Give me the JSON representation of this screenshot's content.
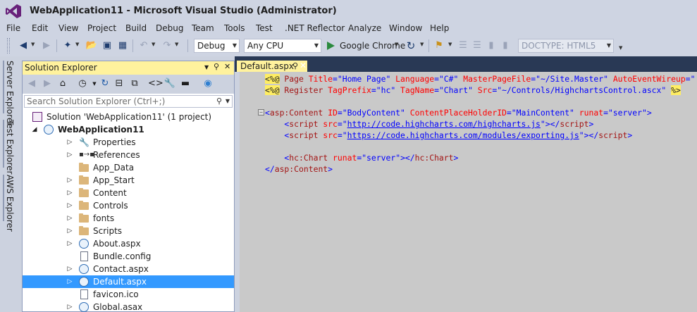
{
  "window": {
    "title": "WebApplication11 - Microsoft Visual Studio (Administrator)"
  },
  "menu": {
    "items": [
      "File",
      "Edit",
      "View",
      "Project",
      "Build",
      "Debug",
      "Team",
      "Tools",
      "Test",
      ".NET Reflector",
      "Analyze",
      "Window",
      "Help"
    ]
  },
  "toolbar": {
    "configuration": "Debug",
    "platform": "Any CPU",
    "run_target": "Google Chrome",
    "doctype": "DOCTYPE: HTML5"
  },
  "side_tabs": [
    "Server Explorer",
    "Test Explorer",
    "AWS Explorer"
  ],
  "solution_explorer": {
    "title": "Solution Explorer",
    "search_placeholder": "Search Solution Explorer (Ctrl+;)",
    "tree": [
      {
        "label": "Solution 'WebApplication11' (1 project)",
        "icon": "solution-icon",
        "level": 0,
        "expander": "none",
        "bold": false
      },
      {
        "label": "WebApplication11",
        "icon": "globe-icon",
        "level": 1,
        "expander": "expanded",
        "bold": true
      },
      {
        "label": "Properties",
        "icon": "wrench-icon",
        "level": 2,
        "expander": "collapsed"
      },
      {
        "label": "References",
        "icon": "references-icon",
        "level": 2,
        "expander": "collapsed"
      },
      {
        "label": "App_Data",
        "icon": "folder-icon",
        "level": 2,
        "expander": "none"
      },
      {
        "label": "App_Start",
        "icon": "folder-icon",
        "level": 2,
        "expander": "collapsed"
      },
      {
        "label": "Content",
        "icon": "folder-icon",
        "level": 2,
        "expander": "collapsed"
      },
      {
        "label": "Controls",
        "icon": "folder-icon",
        "level": 2,
        "expander": "collapsed"
      },
      {
        "label": "fonts",
        "icon": "folder-icon",
        "level": 2,
        "expander": "collapsed"
      },
      {
        "label": "Scripts",
        "icon": "folder-icon",
        "level": 2,
        "expander": "collapsed"
      },
      {
        "label": "About.aspx",
        "icon": "web-file-icon",
        "level": 2,
        "expander": "collapsed"
      },
      {
        "label": "Bundle.config",
        "icon": "file-icon",
        "level": 2,
        "expander": "none"
      },
      {
        "label": "Contact.aspx",
        "icon": "web-file-icon",
        "level": 2,
        "expander": "collapsed"
      },
      {
        "label": "Default.aspx",
        "icon": "web-file-icon",
        "level": 2,
        "expander": "collapsed",
        "selected": true
      },
      {
        "label": "favicon.ico",
        "icon": "file-icon",
        "level": 2,
        "expander": "none"
      },
      {
        "label": "Global.asax",
        "icon": "web-file-icon",
        "level": 2,
        "expander": "collapsed"
      }
    ]
  },
  "editor": {
    "tab_label": "Default.aspx",
    "lines": [
      [
        {
          "t": "<%@",
          "c": "hl-dir"
        },
        {
          "t": " Page ",
          "c": "c-maroon"
        },
        {
          "t": "Title",
          "c": "c-red"
        },
        {
          "t": "=",
          "c": "c-blue"
        },
        {
          "t": "\"Home Page\"",
          "c": "c-str"
        },
        {
          "t": " Language",
          "c": "c-red"
        },
        {
          "t": "=",
          "c": "c-blue"
        },
        {
          "t": "\"C#\"",
          "c": "c-str"
        },
        {
          "t": " MasterPageFile",
          "c": "c-red"
        },
        {
          "t": "=",
          "c": "c-blue"
        },
        {
          "t": "\"~/Site.Master\"",
          "c": "c-str"
        },
        {
          "t": " AutoEventWireup",
          "c": "c-red"
        },
        {
          "t": "=",
          "c": "c-blue"
        },
        {
          "t": "\"",
          "c": "c-str"
        }
      ],
      [
        {
          "t": "<%@",
          "c": "hl-dir"
        },
        {
          "t": " Register ",
          "c": "c-maroon"
        },
        {
          "t": "TagPrefix",
          "c": "c-red"
        },
        {
          "t": "=",
          "c": "c-blue"
        },
        {
          "t": "\"hc\"",
          "c": "c-str"
        },
        {
          "t": " TagName",
          "c": "c-red"
        },
        {
          "t": "=",
          "c": "c-blue"
        },
        {
          "t": "\"Chart\"",
          "c": "c-str"
        },
        {
          "t": " Src",
          "c": "c-red"
        },
        {
          "t": "=",
          "c": "c-blue"
        },
        {
          "t": "\"~/Controls/HighchartsControl.ascx\"",
          "c": "c-str"
        },
        {
          "t": " ",
          "c": "c-plain"
        },
        {
          "t": "%>",
          "c": "hl-dir"
        }
      ],
      [],
      [
        {
          "t": "<",
          "c": "c-blue"
        },
        {
          "t": "asp:Content",
          "c": "c-maroon"
        },
        {
          "t": " ID",
          "c": "c-red"
        },
        {
          "t": "=",
          "c": "c-blue"
        },
        {
          "t": "\"BodyContent\"",
          "c": "c-str"
        },
        {
          "t": " ContentPlaceHolderID",
          "c": "c-red"
        },
        {
          "t": "=",
          "c": "c-blue"
        },
        {
          "t": "\"MainContent\"",
          "c": "c-str"
        },
        {
          "t": " runat",
          "c": "c-red"
        },
        {
          "t": "=",
          "c": "c-blue"
        },
        {
          "t": "\"server\"",
          "c": "c-str"
        },
        {
          "t": ">",
          "c": "c-blue"
        }
      ],
      [
        {
          "t": "    <",
          "c": "c-blue"
        },
        {
          "t": "script",
          "c": "c-maroon"
        },
        {
          "t": " src",
          "c": "c-red"
        },
        {
          "t": "=",
          "c": "c-blue"
        },
        {
          "t": "\"",
          "c": "c-str"
        },
        {
          "t": "http://code.highcharts.com/highcharts.js",
          "c": "c-link"
        },
        {
          "t": "\"",
          "c": "c-str"
        },
        {
          "t": "></",
          "c": "c-blue"
        },
        {
          "t": "script",
          "c": "c-maroon"
        },
        {
          "t": ">",
          "c": "c-blue"
        }
      ],
      [
        {
          "t": "    <",
          "c": "c-blue"
        },
        {
          "t": "script",
          "c": "c-maroon"
        },
        {
          "t": " src",
          "c": "c-red"
        },
        {
          "t": "=",
          "c": "c-blue"
        },
        {
          "t": "\"",
          "c": "c-str"
        },
        {
          "t": "https://code.highcharts.com/modules/exporting.js",
          "c": "c-link"
        },
        {
          "t": "\"",
          "c": "c-str"
        },
        {
          "t": "></",
          "c": "c-blue"
        },
        {
          "t": "script",
          "c": "c-maroon"
        },
        {
          "t": ">",
          "c": "c-blue"
        }
      ],
      [],
      [
        {
          "t": "    <",
          "c": "c-blue"
        },
        {
          "t": "hc:Chart",
          "c": "c-maroon"
        },
        {
          "t": " runat",
          "c": "c-red"
        },
        {
          "t": "=",
          "c": "c-blue"
        },
        {
          "t": "\"server\"",
          "c": "c-str"
        },
        {
          "t": "></",
          "c": "c-blue"
        },
        {
          "t": "hc:Chart",
          "c": "c-maroon"
        },
        {
          "t": ">",
          "c": "c-blue"
        }
      ],
      [
        {
          "t": "</",
          "c": "c-blue"
        },
        {
          "t": "asp:Content",
          "c": "c-maroon"
        },
        {
          "t": ">",
          "c": "c-blue"
        }
      ]
    ]
  },
  "colors": {
    "chrome": "#ced4e2",
    "active_tab": "#fff29d",
    "selection": "#3399ff",
    "editor_bg": "#c9c9c9",
    "tabbar": "#293955"
  }
}
